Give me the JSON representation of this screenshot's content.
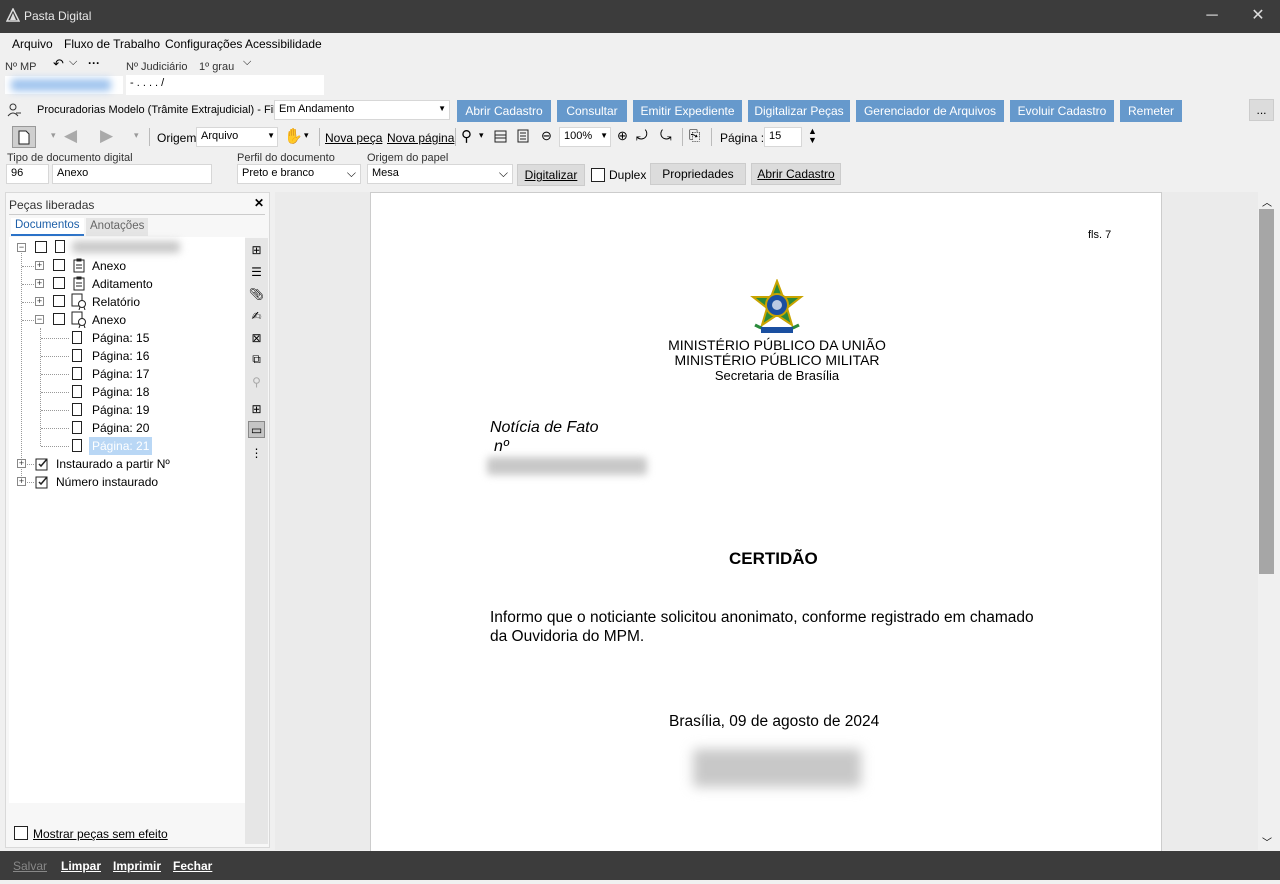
{
  "window": {
    "title": "Pasta Digital",
    "minimize": "─",
    "close": "✕"
  },
  "menu": {
    "items": [
      "Arquivo",
      "Fluxo de Trabalho",
      "Configurações",
      "Acessibilidade"
    ]
  },
  "header": {
    "nmp_label": "Nº MP",
    "judicial_label": "Nº Judiciário",
    "grau": "1º grau",
    "judicial_value": "- .   . . .  /"
  },
  "queue": {
    "label": "Procuradorias Modelo (Trâmite Extrajudicial) - Fila",
    "value": "Em Andamento",
    "buttons": [
      "Abrir Cadastro",
      "Consultar",
      "Emitir Expediente",
      "Digitalizar Peças",
      "Gerenciador de Arquivos",
      "Evoluir Cadastro",
      "Remeter"
    ],
    "more": "..."
  },
  "toolbar": {
    "origem_label": "Origem",
    "origem_value": "Arquivo",
    "nova_peca": "Nova peça",
    "nova_pagina": "Nova página",
    "zoom": "100%",
    "pagina_label": "Página :",
    "pagina_value": "15"
  },
  "docfields": {
    "tipo_label": "Tipo de documento digital",
    "tipo_code": "96",
    "tipo_value": "Anexo",
    "perfil_label": "Perfil do documento",
    "perfil_value": "Preto e branco",
    "origem_papel_label": "Origem do papel",
    "origem_papel_value": "Mesa",
    "digitalizar": "Digitalizar",
    "duplex": "Duplex",
    "propriedades": "Propriedades",
    "abrir_cadastro": "Abrir Cadastro"
  },
  "leftpanel": {
    "title": "Peças liberadas",
    "close": "✕",
    "tabs": [
      "Documentos",
      "Anotações"
    ],
    "tree": {
      "children": [
        "Anexo",
        "Aditamento",
        "Relatório",
        "Anexo"
      ],
      "pages": [
        "Página: 15",
        "Página: 16",
        "Página: 17",
        "Página: 18",
        "Página: 19",
        "Página: 20",
        "Página: 21"
      ],
      "others": [
        "Instaurado a partir Nº",
        "Número instaurado"
      ]
    },
    "show_no_effect": "Mostrar peças sem efeito"
  },
  "document": {
    "fls": "fls. 7",
    "org1": "MINISTÉRIO PÚBLICO DA UNIÃO",
    "org2": "MINISTÉRIO PÚBLICO MILITAR",
    "org3": "Secretaria de Brasília",
    "noticia": "Notícia de Fato",
    "numero": "nº",
    "heading": "CERTIDÃO",
    "body1": "Informo que o noticiante solicitou anonimato, conforme registrado em chamado",
    "body2": "da Ouvidoria do MPM.",
    "date": "Brasília, 09 de agosto de 2024"
  },
  "footer": {
    "buttons": [
      "Salvar",
      "Limpar",
      "Imprimir",
      "Fechar"
    ]
  }
}
